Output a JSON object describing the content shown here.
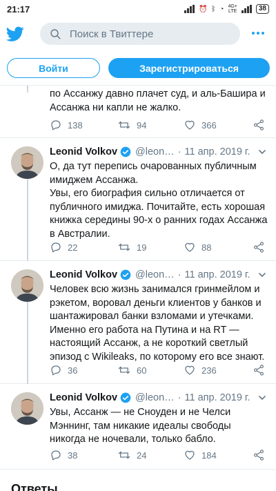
{
  "status": {
    "time": "21:17",
    "net_top": "4G+",
    "net_bottom": "LTE",
    "battery": "38"
  },
  "header": {
    "search_placeholder": "Поиск в Твиттере"
  },
  "auth": {
    "login": "Войти",
    "signup": "Зарегистрироваться"
  },
  "tweets": [
    {
      "text": "по Ассанжу давно плачет суд, и аль-Башира и Ассанжа ни капли не жалко.",
      "replies": "138",
      "retweets": "94",
      "likes": "366"
    },
    {
      "name": "Leonid Volkov",
      "handle": "@leon…",
      "date": "11 апр. 2019 г.",
      "text": "О, да тут перепись очарованных публичным имиджем Ассанжа.\nУвы, его биография сильно отличается от публичного имиджа. Почитайте, есть хорошая книжка середины 90-х о ранних годах Ассанжа в Австралии.",
      "replies": "22",
      "retweets": "19",
      "likes": "88"
    },
    {
      "name": "Leonid Volkov",
      "handle": "@leon…",
      "date": "11 апр. 2019 г.",
      "text": "Человек всю жизнь занимался гринмейлом и рэкетом, воровал деньги клиентов у банков и шантажировал банки взломами и утечками. Именно его работа на Путина и на RT — настоящий Ассанж, а не короткий светлый эпизод с Wikileaks, по которому его все знают.",
      "replies": "36",
      "retweets": "60",
      "likes": "236"
    },
    {
      "name": "Leonid Volkov",
      "handle": "@leon…",
      "date": "11 апр. 2019 г.",
      "text": "Увы, Ассанж — не Сноуден и не Челси Мэннинг, там никакие идеалы свободы никогда не ночевали, только бабло.",
      "replies": "38",
      "retweets": "24",
      "likes": "184"
    }
  ],
  "answers_heading": "Ответы",
  "colors": {
    "accent": "#1da1f2",
    "muted": "#657786",
    "divider": "#e6ecf0"
  },
  "icons": [
    "twitter-logo-icon",
    "search-icon",
    "more-icon",
    "verified-icon",
    "chevron-down-icon",
    "reply-icon",
    "retweet-icon",
    "like-icon",
    "share-icon"
  ]
}
